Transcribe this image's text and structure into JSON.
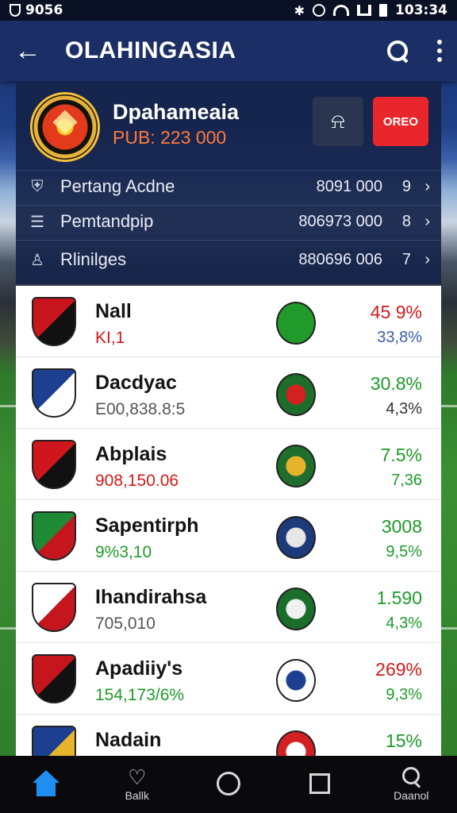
{
  "status_bar": {
    "left_text": "9056",
    "time": "103:34"
  },
  "app_bar": {
    "title": "OLAHINGASIA"
  },
  "header": {
    "club_name": "Dpahameaia",
    "price": "PUB: 223 000",
    "action_label": "OREO",
    "rows": [
      {
        "icon": "shield-icon",
        "glyph": "⛨",
        "label": "Pertang Acdne",
        "value": "8091 000",
        "num": "9"
      },
      {
        "icon": "list-icon",
        "glyph": "☰",
        "label": "Pemtandpip",
        "value": "806973 000",
        "num": "8"
      },
      {
        "icon": "person-icon",
        "glyph": "♙",
        "label": "Rlinilges",
        "value": "880696 006",
        "num": "7"
      }
    ]
  },
  "teams": [
    {
      "name": "Nall",
      "sub": "KI,1",
      "sub_color": "#d11a1a",
      "p1": "45 9%",
      "p1_color": "#d11a1a",
      "p2": "33,8%",
      "p2_color": "#3a5f9e",
      "crest": [
        "#c8141b",
        "#111111"
      ],
      "badge": [
        "#1f9a2b",
        "#1f9a2b"
      ]
    },
    {
      "name": "Dacdyac",
      "sub": "E00,838.8:5",
      "sub_color": "#555555",
      "p1": "30.8%",
      "p1_color": "#1e9a2a",
      "p2": "4,3%",
      "p2_color": "#333333",
      "crest": [
        "#1d3f8f",
        "#ffffff"
      ],
      "badge": [
        "#1d6e2a",
        "#d42020"
      ]
    },
    {
      "name": "Abplais",
      "sub": "908,150.06",
      "sub_color": "#d11a1a",
      "p1": "7.5%",
      "p1_color": "#1e9a2a",
      "p2": "7,36",
      "p2_color": "#1e9a2a",
      "crest": [
        "#d0161d",
        "#111111"
      ],
      "badge": [
        "#1f6e2d",
        "#e5b42a"
      ]
    },
    {
      "name": "Sapentirph",
      "sub": "9%3,10",
      "sub_color": "#1e9a2a",
      "p1": "3008",
      "p1_color": "#1e9a2a",
      "p2": "9,5%",
      "p2_color": "#1e9a2a",
      "crest": [
        "#1e8a35",
        "#c4161c"
      ],
      "badge": [
        "#1d3a7a",
        "#e7e7e7"
      ]
    },
    {
      "name": "Ihandirahsa",
      "sub": "705,010",
      "sub_color": "#555555",
      "p1": "1.590",
      "p1_color": "#1e9a2a",
      "p2": "4,3%",
      "p2_color": "#1e9a2a",
      "crest": [
        "#ffffff",
        "#c4161c"
      ],
      "badge": [
        "#1a6e2a",
        "#f1f1f1"
      ]
    },
    {
      "name": "Apadiiy's",
      "sub": "154,173/6%",
      "sub_color": "#1e9a2a",
      "p1": "269%",
      "p1_color": "#d11a1a",
      "p2": "9,3%",
      "p2_color": "#1e9a2a",
      "crest": [
        "#c4161c",
        "#111111"
      ],
      "badge": [
        "#ffffff",
        "#1d3f8f"
      ]
    },
    {
      "name": "Nadain",
      "sub": "",
      "sub_color": "#555555",
      "p1": "15%",
      "p1_color": "#1e9a2a",
      "p2": "",
      "p2_color": "#1e9a2a",
      "crest": [
        "#1d3f8f",
        "#e5b42a"
      ],
      "badge": [
        "#d42020",
        "#ffffff"
      ]
    }
  ],
  "bottom_nav": [
    {
      "id": "home",
      "label": ""
    },
    {
      "id": "favorites",
      "label": "Ballk"
    },
    {
      "id": "circle",
      "label": ""
    },
    {
      "id": "square",
      "label": ""
    },
    {
      "id": "search",
      "label": "Daanol"
    }
  ]
}
